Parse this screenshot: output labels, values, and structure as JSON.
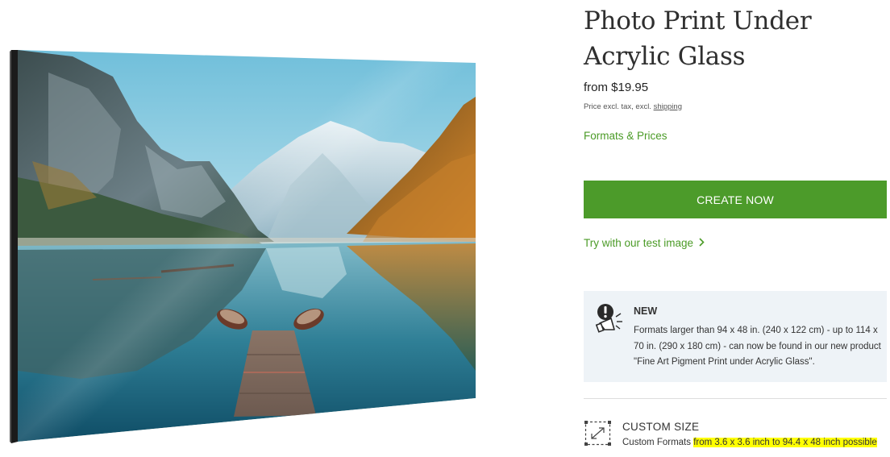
{
  "product": {
    "title": "Photo Print Under Acrylic Glass",
    "price": "from $19.95",
    "price_note_prefix": "Price excl. tax, excl. ",
    "price_note_link": "shipping",
    "formats_link": "Formats & Prices",
    "create_button": "CREATE NOW",
    "test_image_link": "Try with our test image"
  },
  "notice": {
    "icon": "megaphone-alert-icon",
    "heading": "NEW",
    "text": "Formats larger than 94 x 48 in. (240 x 122 cm) - up to 114 x 70 in. (290 x 180 cm) - can now be found in our new product \"Fine Art Pigment Print under Acrylic Glass\"."
  },
  "custom_size": {
    "icon": "resize-arrows-icon",
    "heading": "CUSTOM SIZE",
    "prefix": "Custom Formats ",
    "highlight": "from 3.6 x 3.6 inch to 94.4 x 48 inch possible"
  },
  "colors": {
    "accent_green": "#4c9b2a",
    "link_green": "#4b9b27",
    "notice_bg": "#eef3f7",
    "highlight": "#ffff00"
  },
  "image": {
    "subject": "mountain-lake-with-rowboats-and-pier"
  }
}
